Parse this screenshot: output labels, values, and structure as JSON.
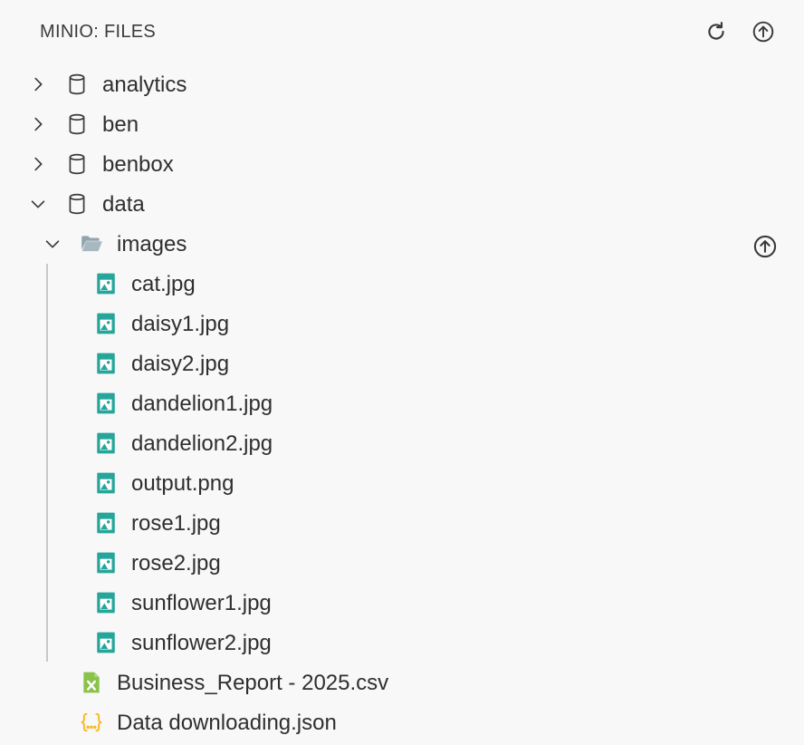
{
  "header": {
    "title": "MINIO: FILES",
    "refresh_icon": "refresh-icon",
    "upload_icon": "upload-icon"
  },
  "tree": {
    "buckets": [
      {
        "label": "analytics",
        "expanded": false
      },
      {
        "label": "ben",
        "expanded": false
      },
      {
        "label": "benbox",
        "expanded": false
      },
      {
        "label": "data",
        "expanded": true
      }
    ],
    "folder": {
      "label": "images",
      "expanded": true
    },
    "image_files": [
      {
        "label": "cat.jpg"
      },
      {
        "label": "daisy1.jpg"
      },
      {
        "label": "daisy2.jpg"
      },
      {
        "label": "dandelion1.jpg"
      },
      {
        "label": "dandelion2.jpg"
      },
      {
        "label": "output.png"
      },
      {
        "label": "rose1.jpg"
      },
      {
        "label": "rose2.jpg"
      },
      {
        "label": "sunflower1.jpg"
      },
      {
        "label": "sunflower2.jpg"
      }
    ],
    "other_files": [
      {
        "label": "Business_Report - 2025.csv",
        "icon": "csv-file-icon"
      },
      {
        "label": "Data downloading.json",
        "icon": "json-file-icon"
      }
    ]
  },
  "colors": {
    "background": "#f8f8f8",
    "text": "#2f2f2f",
    "image_icon": "#26a69a",
    "csv_icon": "#8bc34a",
    "json_icon": "#f9b824",
    "folder_icon": "#90a4ae",
    "guide_line": "#c9c9c9"
  }
}
